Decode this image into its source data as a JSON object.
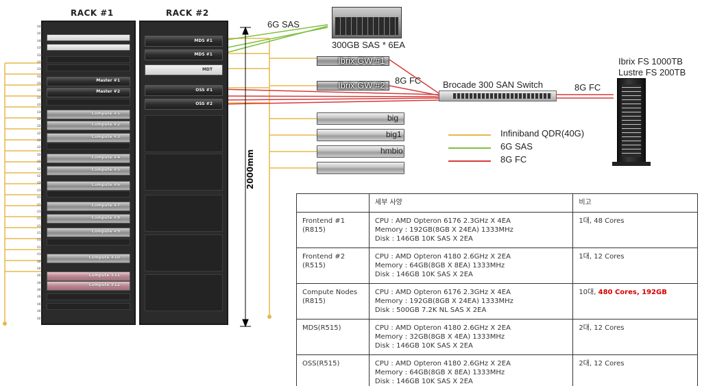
{
  "racks": {
    "rack1_title": "RACK #1",
    "rack2_title": "RACK #2",
    "height_label": "2000mm",
    "u_labels": [
      "U42",
      "U41",
      "U40",
      "U39",
      "U38",
      "U37",
      "U36",
      "U35",
      "U34",
      "U33",
      "U32",
      "U31",
      "U30",
      "U29",
      "U28",
      "U27",
      "U26",
      "U25",
      "U24",
      "U23",
      "U22",
      "U21",
      "U20",
      "U19",
      "U18",
      "U17",
      "U16",
      "U15",
      "U14",
      "U13",
      "U12",
      "U11",
      "U10",
      "U09",
      "U08",
      "U07",
      "U06",
      "U05",
      "U04",
      "U03",
      "U02",
      "U01"
    ],
    "rack1_servers": [
      {
        "label": "",
        "style": "light"
      },
      {
        "label": "",
        "style": "light"
      },
      {
        "label": "Master #1",
        "style": "dark"
      },
      {
        "label": "Master #2",
        "style": "dark"
      },
      {
        "label": "Compute #1",
        "style": "normal"
      },
      {
        "label": "Compute #2",
        "style": "normal"
      },
      {
        "label": "Compute #3",
        "style": "normal"
      },
      {
        "label": "Compute #4",
        "style": "normal"
      },
      {
        "label": "Compute #5",
        "style": "normal"
      },
      {
        "label": "Compute #6",
        "style": "normal"
      },
      {
        "label": "Compute #7",
        "style": "normal"
      },
      {
        "label": "Compute #8",
        "style": "normal"
      },
      {
        "label": "Compute #9",
        "style": "normal"
      },
      {
        "label": "Compute #10",
        "style": "normal"
      },
      {
        "label": "Compute #11",
        "style": "pink"
      },
      {
        "label": "Compute #12",
        "style": "pink"
      }
    ],
    "rack2_servers": [
      {
        "label": "MDS #1",
        "style": "dark"
      },
      {
        "label": "MDS #1",
        "style": "dark"
      },
      {
        "label": "MDT",
        "style": "light"
      },
      {
        "label": "OSS #1",
        "style": "dark"
      },
      {
        "label": "OSS #2",
        "style": "dark"
      }
    ]
  },
  "storage": {
    "sas_link_label": "6G SAS",
    "enclosure_label": "300GB SAS * 6EA",
    "gw1_label": "Ibrix GW #1",
    "gw2_label": "Ibrix GW #2",
    "fc_link_label_left": "8G FC",
    "switch_label": "Brocade 300 SAN Switch",
    "fc_link_label_right": "8G FC",
    "array_label_line1": "Ibrix FS  1000TB",
    "array_label_line2": "Lustre FS 200TB"
  },
  "nodes": {
    "labels": [
      "big",
      "big1",
      "hmbio",
      ""
    ]
  },
  "legend": {
    "items": [
      {
        "label": "Infiniband QDR(40G)",
        "color": "#e6b84a"
      },
      {
        "label": "6G SAS",
        "color": "#7fbf3f"
      },
      {
        "label": "8G FC",
        "color": "#d63a3a"
      }
    ]
  },
  "spec_table": {
    "headers": [
      "",
      "세부 사양",
      "비고"
    ],
    "rows": [
      {
        "name": [
          "Frontend #1",
          "(R815)"
        ],
        "spec": [
          "CPU : AMD Opteron  6176  2.3GHz  X 4EA",
          "Memory : 192GB(8GB  X 24EA) 1333MHz",
          "Disk : 146GB  10K  SAS X 2EA"
        ],
        "note": "1대, 48 Cores",
        "note_highlight": ""
      },
      {
        "name": [
          "Frontend #2",
          "(R515)"
        ],
        "spec": [
          "CPU :  AMD Opteron  4180  2.6GHz  X 2EA",
          "Memory : 64GB(8GB  X 8EA) 1333MHz",
          "Disk : 146GB  10K  SAS X 2EA"
        ],
        "note": "1대, 12 Cores",
        "note_highlight": ""
      },
      {
        "name": [
          "Compute Nodes",
          "(R815)"
        ],
        "spec": [
          "CPU : AMD Opteron  6176  2.3GHz  X 4EA",
          "Memory : 192GB(8GB  X 24EA) 1333MHz",
          "Disk : 500GB  7.2K  NL SAS X 2EA"
        ],
        "note": "10대, ",
        "note_highlight": "480 Cores, 192GB"
      },
      {
        "name": [
          "MDS(R515)",
          ""
        ],
        "spec": [
          "CPU : AMD Opteron  4180  2.6GHz  X 2EA",
          "Memory : 32GB(8GB  X 4EA) 1333MHz",
          "Disk : 146GB  10K  SAS X 2EA"
        ],
        "note": "2대, 12 Cores",
        "note_highlight": ""
      },
      {
        "name": [
          "OSS(R515)",
          ""
        ],
        "spec": [
          "CPU : AMD Opteron  4180  2.6GHz  X 2EA",
          "Memory : 64GB(8GB  X 8EA) 1333MHz",
          "Disk : 146GB  10K  SAS X 2EA"
        ],
        "note": "2대, 12 Cores",
        "note_highlight": ""
      }
    ]
  }
}
